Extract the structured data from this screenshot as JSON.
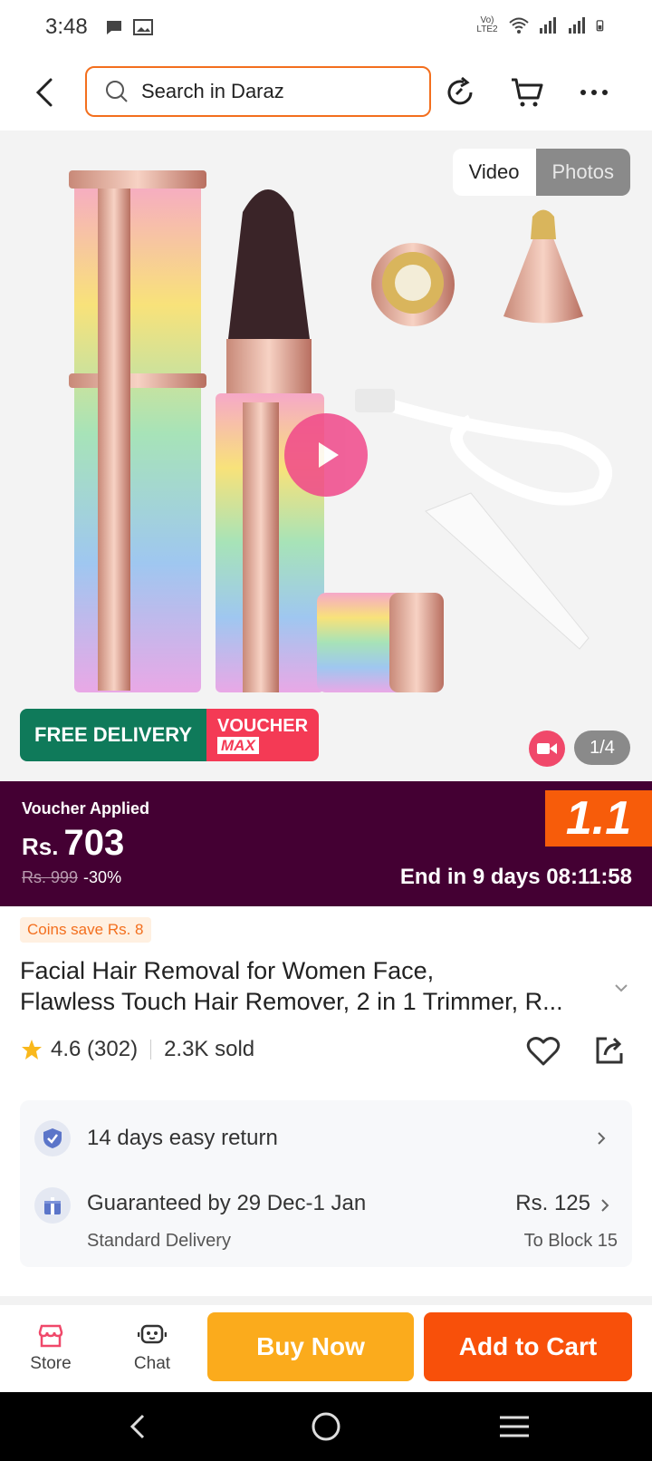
{
  "status_bar": {
    "time": "3:48",
    "network_label": "Vo) LTE2"
  },
  "header": {
    "search_placeholder": "Search in Daraz"
  },
  "gallery": {
    "toggle": [
      "Video",
      "Photos"
    ],
    "active_toggle": "Video",
    "promo_free_delivery": "FREE DELIVERY",
    "promo_voucher": "VOUCHER",
    "promo_max": "MAX",
    "counter": "1/4"
  },
  "voucher_bar": {
    "label": "Voucher Applied",
    "currency": "Rs.",
    "price": "703",
    "old_price": "Rs. 999",
    "discount": "-30%",
    "campaign_badge": "1.1",
    "ends_in": "End in 9 days 08:11:58",
    "bg_color": "#440033",
    "badge_color": "#f75c0a"
  },
  "product": {
    "coins": "Coins save Rs. 8",
    "title_line1": "Facial Hair Removal for Women Face,",
    "title_line2": "Flawless Touch Hair Remover, 2 in 1 Trimmer, R...",
    "rating": "4.6 (302)",
    "sold": "2.3K sold"
  },
  "delivery": {
    "returns": "14 days easy return",
    "guarantee": "Guaranteed by 29 Dec-1 Jan",
    "method": "Standard Delivery",
    "fee": "Rs. 125",
    "to": "To Block 15"
  },
  "action_bar": {
    "store": "Store",
    "chat": "Chat",
    "buy_now": "Buy Now",
    "add_to_cart": "Add to Cart",
    "buy_color": "#fbab1c",
    "cart_color": "#f8500a"
  }
}
